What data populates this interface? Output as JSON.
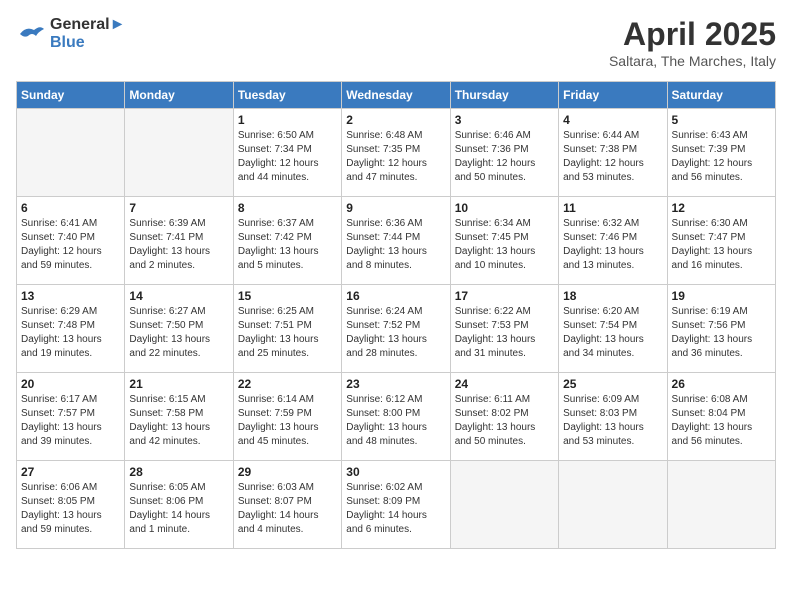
{
  "header": {
    "logo_line1": "General",
    "logo_line2": "Blue",
    "month_title": "April 2025",
    "subtitle": "Saltara, The Marches, Italy"
  },
  "weekdays": [
    "Sunday",
    "Monday",
    "Tuesday",
    "Wednesday",
    "Thursday",
    "Friday",
    "Saturday"
  ],
  "weeks": [
    [
      {
        "day": "",
        "info": ""
      },
      {
        "day": "",
        "info": ""
      },
      {
        "day": "1",
        "info": "Sunrise: 6:50 AM\nSunset: 7:34 PM\nDaylight: 12 hours\nand 44 minutes."
      },
      {
        "day": "2",
        "info": "Sunrise: 6:48 AM\nSunset: 7:35 PM\nDaylight: 12 hours\nand 47 minutes."
      },
      {
        "day": "3",
        "info": "Sunrise: 6:46 AM\nSunset: 7:36 PM\nDaylight: 12 hours\nand 50 minutes."
      },
      {
        "day": "4",
        "info": "Sunrise: 6:44 AM\nSunset: 7:38 PM\nDaylight: 12 hours\nand 53 minutes."
      },
      {
        "day": "5",
        "info": "Sunrise: 6:43 AM\nSunset: 7:39 PM\nDaylight: 12 hours\nand 56 minutes."
      }
    ],
    [
      {
        "day": "6",
        "info": "Sunrise: 6:41 AM\nSunset: 7:40 PM\nDaylight: 12 hours\nand 59 minutes."
      },
      {
        "day": "7",
        "info": "Sunrise: 6:39 AM\nSunset: 7:41 PM\nDaylight: 13 hours\nand 2 minutes."
      },
      {
        "day": "8",
        "info": "Sunrise: 6:37 AM\nSunset: 7:42 PM\nDaylight: 13 hours\nand 5 minutes."
      },
      {
        "day": "9",
        "info": "Sunrise: 6:36 AM\nSunset: 7:44 PM\nDaylight: 13 hours\nand 8 minutes."
      },
      {
        "day": "10",
        "info": "Sunrise: 6:34 AM\nSunset: 7:45 PM\nDaylight: 13 hours\nand 10 minutes."
      },
      {
        "day": "11",
        "info": "Sunrise: 6:32 AM\nSunset: 7:46 PM\nDaylight: 13 hours\nand 13 minutes."
      },
      {
        "day": "12",
        "info": "Sunrise: 6:30 AM\nSunset: 7:47 PM\nDaylight: 13 hours\nand 16 minutes."
      }
    ],
    [
      {
        "day": "13",
        "info": "Sunrise: 6:29 AM\nSunset: 7:48 PM\nDaylight: 13 hours\nand 19 minutes."
      },
      {
        "day": "14",
        "info": "Sunrise: 6:27 AM\nSunset: 7:50 PM\nDaylight: 13 hours\nand 22 minutes."
      },
      {
        "day": "15",
        "info": "Sunrise: 6:25 AM\nSunset: 7:51 PM\nDaylight: 13 hours\nand 25 minutes."
      },
      {
        "day": "16",
        "info": "Sunrise: 6:24 AM\nSunset: 7:52 PM\nDaylight: 13 hours\nand 28 minutes."
      },
      {
        "day": "17",
        "info": "Sunrise: 6:22 AM\nSunset: 7:53 PM\nDaylight: 13 hours\nand 31 minutes."
      },
      {
        "day": "18",
        "info": "Sunrise: 6:20 AM\nSunset: 7:54 PM\nDaylight: 13 hours\nand 34 minutes."
      },
      {
        "day": "19",
        "info": "Sunrise: 6:19 AM\nSunset: 7:56 PM\nDaylight: 13 hours\nand 36 minutes."
      }
    ],
    [
      {
        "day": "20",
        "info": "Sunrise: 6:17 AM\nSunset: 7:57 PM\nDaylight: 13 hours\nand 39 minutes."
      },
      {
        "day": "21",
        "info": "Sunrise: 6:15 AM\nSunset: 7:58 PM\nDaylight: 13 hours\nand 42 minutes."
      },
      {
        "day": "22",
        "info": "Sunrise: 6:14 AM\nSunset: 7:59 PM\nDaylight: 13 hours\nand 45 minutes."
      },
      {
        "day": "23",
        "info": "Sunrise: 6:12 AM\nSunset: 8:00 PM\nDaylight: 13 hours\nand 48 minutes."
      },
      {
        "day": "24",
        "info": "Sunrise: 6:11 AM\nSunset: 8:02 PM\nDaylight: 13 hours\nand 50 minutes."
      },
      {
        "day": "25",
        "info": "Sunrise: 6:09 AM\nSunset: 8:03 PM\nDaylight: 13 hours\nand 53 minutes."
      },
      {
        "day": "26",
        "info": "Sunrise: 6:08 AM\nSunset: 8:04 PM\nDaylight: 13 hours\nand 56 minutes."
      }
    ],
    [
      {
        "day": "27",
        "info": "Sunrise: 6:06 AM\nSunset: 8:05 PM\nDaylight: 13 hours\nand 59 minutes."
      },
      {
        "day": "28",
        "info": "Sunrise: 6:05 AM\nSunset: 8:06 PM\nDaylight: 14 hours\nand 1 minute."
      },
      {
        "day": "29",
        "info": "Sunrise: 6:03 AM\nSunset: 8:07 PM\nDaylight: 14 hours\nand 4 minutes."
      },
      {
        "day": "30",
        "info": "Sunrise: 6:02 AM\nSunset: 8:09 PM\nDaylight: 14 hours\nand 6 minutes."
      },
      {
        "day": "",
        "info": ""
      },
      {
        "day": "",
        "info": ""
      },
      {
        "day": "",
        "info": ""
      }
    ]
  ]
}
